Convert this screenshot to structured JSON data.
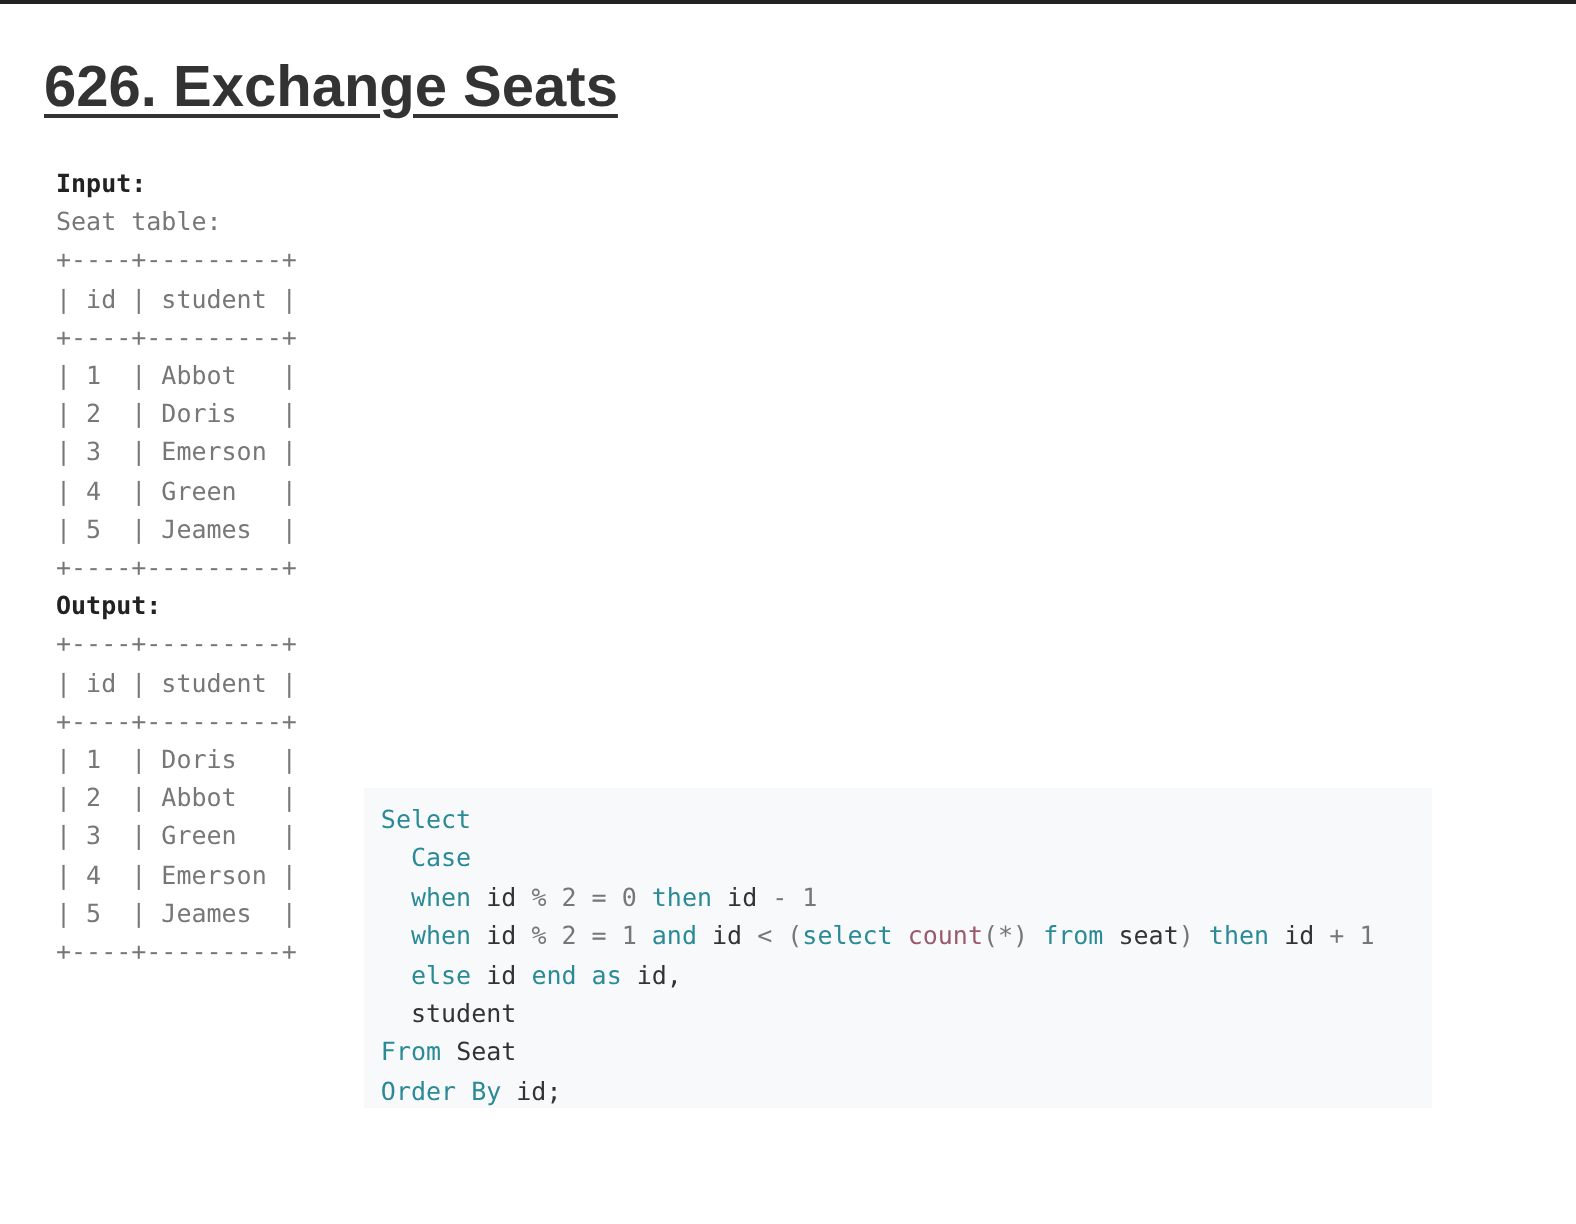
{
  "title": "626. Exchange Seats",
  "example": [
    {
      "kind": "label",
      "text": "Input:"
    },
    {
      "kind": "text",
      "text": "Seat table:"
    },
    {
      "kind": "text",
      "text": "+----+---------+"
    },
    {
      "kind": "text",
      "text": "| id | student |"
    },
    {
      "kind": "text",
      "text": "+----+---------+"
    },
    {
      "kind": "text",
      "text": "| 1  | Abbot   |"
    },
    {
      "kind": "text",
      "text": "| 2  | Doris   |"
    },
    {
      "kind": "text",
      "text": "| 3  | Emerson |"
    },
    {
      "kind": "text",
      "text": "| 4  | Green   |"
    },
    {
      "kind": "text",
      "text": "| 5  | Jeames  |"
    },
    {
      "kind": "text",
      "text": "+----+---------+"
    },
    {
      "kind": "label",
      "text": "Output:"
    },
    {
      "kind": "text",
      "text": "+----+---------+"
    },
    {
      "kind": "text",
      "text": "| id | student |"
    },
    {
      "kind": "text",
      "text": "+----+---------+"
    },
    {
      "kind": "text",
      "text": "| 1  | Doris   |"
    },
    {
      "kind": "text",
      "text": "| 2  | Abbot   |"
    },
    {
      "kind": "text",
      "text": "| 3  | Green   |"
    },
    {
      "kind": "text",
      "text": "| 4  | Emerson |"
    },
    {
      "kind": "text",
      "text": "| 5  | Jeames  |"
    },
    {
      "kind": "text",
      "text": "+----+---------+"
    }
  ],
  "code": [
    [
      {
        "kind": "keyword",
        "text": "Select"
      }
    ],
    [
      {
        "kind": "keyword",
        "text": "  Case"
      }
    ],
    [
      {
        "kind": "keyword",
        "text": "  when "
      },
      {
        "kind": "ident",
        "text": "id "
      },
      {
        "kind": "op",
        "text": "% 2 = 0 "
      },
      {
        "kind": "keyword",
        "text": "then "
      },
      {
        "kind": "ident",
        "text": "id "
      },
      {
        "kind": "op",
        "text": "- 1"
      }
    ],
    [
      {
        "kind": "keyword",
        "text": "  when "
      },
      {
        "kind": "ident",
        "text": "id "
      },
      {
        "kind": "op",
        "text": "% 2 = 1 "
      },
      {
        "kind": "keyword",
        "text": "and "
      },
      {
        "kind": "ident",
        "text": "id "
      },
      {
        "kind": "op",
        "text": "< ("
      },
      {
        "kind": "keyword",
        "text": "select "
      },
      {
        "kind": "func",
        "text": "count"
      },
      {
        "kind": "op",
        "text": "(*) "
      },
      {
        "kind": "keyword",
        "text": "from "
      },
      {
        "kind": "ident",
        "text": "seat"
      },
      {
        "kind": "op",
        "text": ") "
      },
      {
        "kind": "keyword",
        "text": "then "
      },
      {
        "kind": "ident",
        "text": "id "
      },
      {
        "kind": "op",
        "text": "+ 1"
      }
    ],
    [
      {
        "kind": "keyword",
        "text": "  else "
      },
      {
        "kind": "ident",
        "text": "id "
      },
      {
        "kind": "keyword",
        "text": "end as "
      },
      {
        "kind": "ident",
        "text": "id,"
      }
    ],
    [
      {
        "kind": "ident",
        "text": "  student"
      }
    ],
    [
      {
        "kind": "keyword",
        "text": "From "
      },
      {
        "kind": "ident",
        "text": "Seat"
      }
    ],
    [
      {
        "kind": "keyword",
        "text": "Order By "
      },
      {
        "kind": "ident",
        "text": "id;"
      }
    ]
  ]
}
